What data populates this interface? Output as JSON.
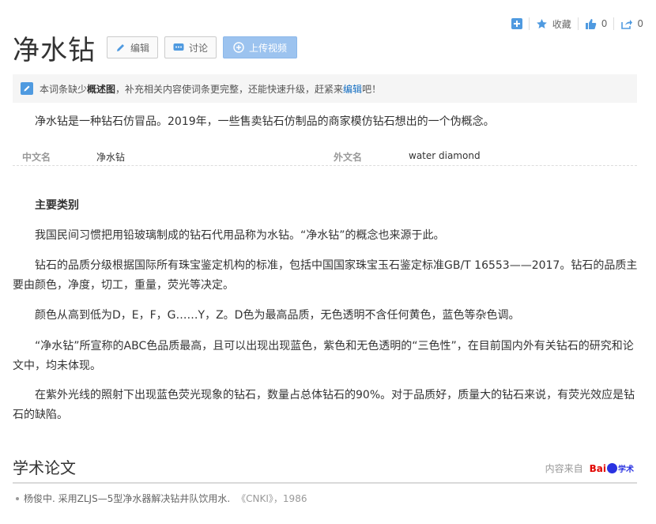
{
  "toolbar_top": {
    "collect_label": "收藏",
    "like_count": "0",
    "share_count": "0"
  },
  "header": {
    "title": "净水钻",
    "edit_label": "编辑",
    "discuss_label": "讨论",
    "upload_label": "上传视频"
  },
  "notice": {
    "prefix": "本词条缺少",
    "missing": "概述图",
    "middle": "，补充相关内容使词条更完整，还能快速升级，赶紧来",
    "link": "编辑",
    "suffix": "吧！"
  },
  "summary": "净水钻是一种钻石仿冒品。2019年，一些售卖钻石仿制品的商家模仿钻石想出的一个伪概念。",
  "basic_info": {
    "cn_name_key": "中文名",
    "cn_name_value": "净水钻",
    "foreign_name_key": "外文名",
    "foreign_name_value": "water diamond"
  },
  "section": {
    "title": "主要类别",
    "paragraphs": [
      "我国民间习惯把用铅玻璃制成的钻石代用品称为水钻。“净水钻”的概念也来源于此。",
      "钻石的品质分级根据国际所有珠宝鉴定机构的标准，包括中国国家珠宝玉石鉴定标准GB/T 16553——2017。钻石的品质主要由颜色，净度，切工，重量，荧光等决定。",
      "颜色从高到低为D，E，F，G……Y，Z。D色为最高品质，无色透明不含任何黄色，蓝色等杂色调。",
      "“净水钻”所宣称的ABC色品质最高，且可以出现出现蓝色，紫色和无色透明的“三色性”，在目前国内外有关钻石的研究和论文中，均未体现。",
      "在紫外光线的照射下出现蓝色荧光现象的钻石，数量占总体钻石的90%。对于品质好，质量大的钻石来说，有荧光效应是钻石的缺陷。"
    ]
  },
  "papers": {
    "title": "学术论文",
    "source_label": "内容来自",
    "logo_text": "Bai",
    "logo_sub": "学术",
    "items": [
      {
        "text": "杨俊中. 采用ZLJS—5型净水器解决钻井队饮用水.",
        "journal": "《CNKI》，1986"
      }
    ]
  },
  "colors": {
    "accent": "#136ec2",
    "upload_button": "#9cc3ef",
    "icon_blue": "#4f9ae0"
  }
}
